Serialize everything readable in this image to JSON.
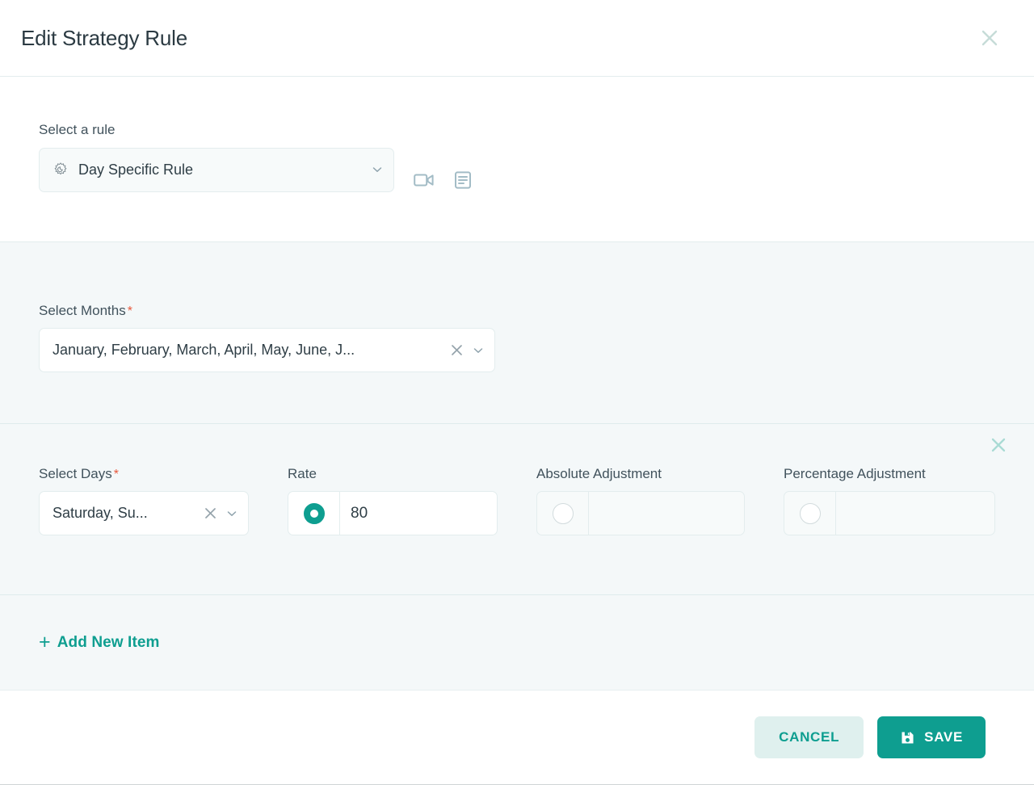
{
  "dialog": {
    "title": "Edit Strategy Rule",
    "close_icon": "close-icon"
  },
  "rule_section": {
    "label": "Select a rule",
    "selected": "Day Specific Rule",
    "rule_icon": "sun-moon-icon",
    "chevron_icon": "chevron-down-icon",
    "video_icon": "video-camera-icon",
    "doc_icon": "document-icon"
  },
  "months_section": {
    "label": "Select Months",
    "required_mark": "*",
    "selected": "January, February, March, April, May, June, J...",
    "clear_icon": "close-icon",
    "chevron_icon": "chevron-down-icon"
  },
  "item_row": {
    "remove_icon": "close-icon",
    "days": {
      "label": "Select Days",
      "required_mark": "*",
      "selected": "Saturday, Su...",
      "clear_icon": "close-icon",
      "chevron_icon": "chevron-down-icon"
    },
    "rate": {
      "label": "Rate",
      "value": "80",
      "selected": true
    },
    "absolute_adjustment": {
      "label": "Absolute Adjustment",
      "value": "",
      "selected": false
    },
    "percentage_adjustment": {
      "label": "Percentage Adjustment",
      "value": "",
      "selected": false
    }
  },
  "add_item": {
    "plus": "+",
    "label": "Add New Item"
  },
  "footer": {
    "cancel_label": "CANCEL",
    "save_label": "SAVE",
    "save_icon": "save-disk-icon"
  },
  "colors": {
    "accent": "#0e9e90",
    "accent_soft": "#dff0ee",
    "section_bg": "#f4f8f9",
    "required": "#e8583c",
    "icon_slate": "#a3bcc6",
    "close_muted": "#c6dcd8"
  }
}
